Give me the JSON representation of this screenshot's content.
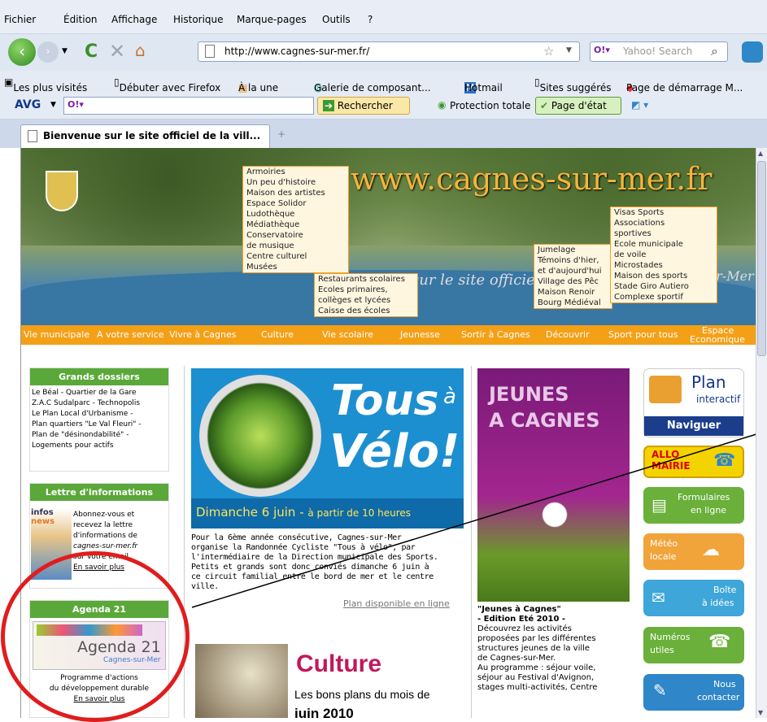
{
  "menubar": {
    "items": [
      "Fichier",
      "Édition",
      "Affichage",
      "Historique",
      "Marque-pages",
      "Outils",
      "?"
    ]
  },
  "navbar": {
    "url": "http://www.cagnes-sur-mer.fr/",
    "search_placeholder": "Yahoo! Search"
  },
  "bookmarks": [
    "Les plus visités",
    "Débuter avec Firefox",
    "À la une",
    "Galerie de composant...",
    "Hotmail",
    "Sites suggérés",
    "Page de démarrage M..."
  ],
  "avg": {
    "logo": "AVG",
    "search_btn": "Rechercher",
    "protection": "Protection totale",
    "page_etat": "Page d'état"
  },
  "tab": {
    "title": "Bienvenue sur le site officiel de la vill..."
  },
  "banner": {
    "url_text": "www.cagnes-sur-mer.fr",
    "slogan": "sur le site officiel",
    "slogan2": "s-sur-Mer"
  },
  "menu": [
    "Vie municipale",
    "A votre service",
    "Vivre à Cagnes",
    "Culture",
    "Vie scolaire",
    "Jeunesse",
    "Sortir à Cagnes",
    "Découvrir",
    "Sport pour tous",
    "Espace",
    "Economique"
  ],
  "dropdown_culture": [
    "Armoiries",
    "Un peu d'histoire",
    "Maison des artistes",
    "Espace Solidor",
    "Ludothèque",
    "Médiathèque",
    "Conservatoire",
    "de musique",
    "Centre culturel",
    "Musées"
  ],
  "dropdown_scolaire": [
    "Restaurants scolaires",
    "Ecoles primaires,",
    "collèges et lycées",
    "Caisse des écoles"
  ],
  "dropdown_decouvrir": [
    "Jumelage",
    "Témoins d'hier,",
    "et d'aujourd'hui",
    "Village des Pêc",
    "Maison Renoir",
    "Bourg Médiéval"
  ],
  "dropdown_sport": [
    "Visas Sports",
    "Associations",
    "sportives",
    "Ecole municipale",
    "de voile",
    "Microstades",
    "Maison des sports",
    "Stade Giro Autiero",
    "Complexe sportif"
  ],
  "grands_dossiers": {
    "title": "Grands dossiers",
    "links": [
      "Le Béal - Quartier de la Gare",
      "Z.A.C Sudalparc - Technopolis",
      "Le Plan Local d'Urbanisme -",
      "Plan quartiers \"Le Val Fleuri\" -",
      "Plan de \"désinondabilité\" -",
      "Logements pour actifs"
    ]
  },
  "lettre": {
    "title": "Lettre d'informations",
    "img_label": "infos",
    "img_label2": "news",
    "text": [
      "Abonnez-vous et",
      "recevez la lettre",
      "d'informations de",
      "cagnes-sur-mer.fr",
      "sur votre email"
    ],
    "link": "En savoir plus"
  },
  "agenda": {
    "title": "Agenda 21",
    "logo": "Agenda 21",
    "logo_sub": "Cagnes-sur-Mer",
    "text1": "Programme d'actions",
    "text2": "du développement durable",
    "link": "En savoir plus"
  },
  "velo": {
    "title1": "Tous",
    "title_a": "à",
    "title2": "Vélo!",
    "date": "Dimanche 6 juin -",
    "time": "à partir de 10 heures",
    "text": [
      "Pour la 6ème année consécutive, Cagnes-sur-Mer",
      "organise la Randonnée Cycliste \"Tous à vélo\", par",
      "l'intermédiaire de la Direction municipale des Sports.",
      "Petits et grands sont donc conviés dimanche 6 juin à",
      "ce circuit familial entre le bord de mer et le centre",
      "ville."
    ],
    "link": "Plan disponible en ligne"
  },
  "culture": {
    "title": "Culture",
    "sub": "Les bons plans du mois de",
    "sub2": "juin 2010"
  },
  "jeunes": {
    "title1": "JEUNES",
    "title2": "A CAGNES",
    "head1": "\"Jeunes à Cagnes\"",
    "head2": "- Edition Eté 2010 -",
    "text": [
      "Découvrez les activités",
      "proposées par les différentes",
      "structures jeunes de la ville",
      "de Cagnes-sur-Mer.",
      "Au programme : séjour voile,",
      "séjour au Festival d'Avignon,",
      "stages multi-activités, Centre"
    ]
  },
  "right": {
    "plan1": "Plan",
    "plan2": "interactif",
    "naviguer": "Naviguer",
    "allo1": "ALLO",
    "allo2": "MAIRIE",
    "form1": "Formulaires",
    "form2": "en ligne",
    "meteo1": "Météo",
    "meteo2": "locale",
    "boite1": "Boîte",
    "boite2": "à idées",
    "num1": "Numéros",
    "num2": "utiles",
    "contact1": "Nous",
    "contact2": "contacter"
  }
}
